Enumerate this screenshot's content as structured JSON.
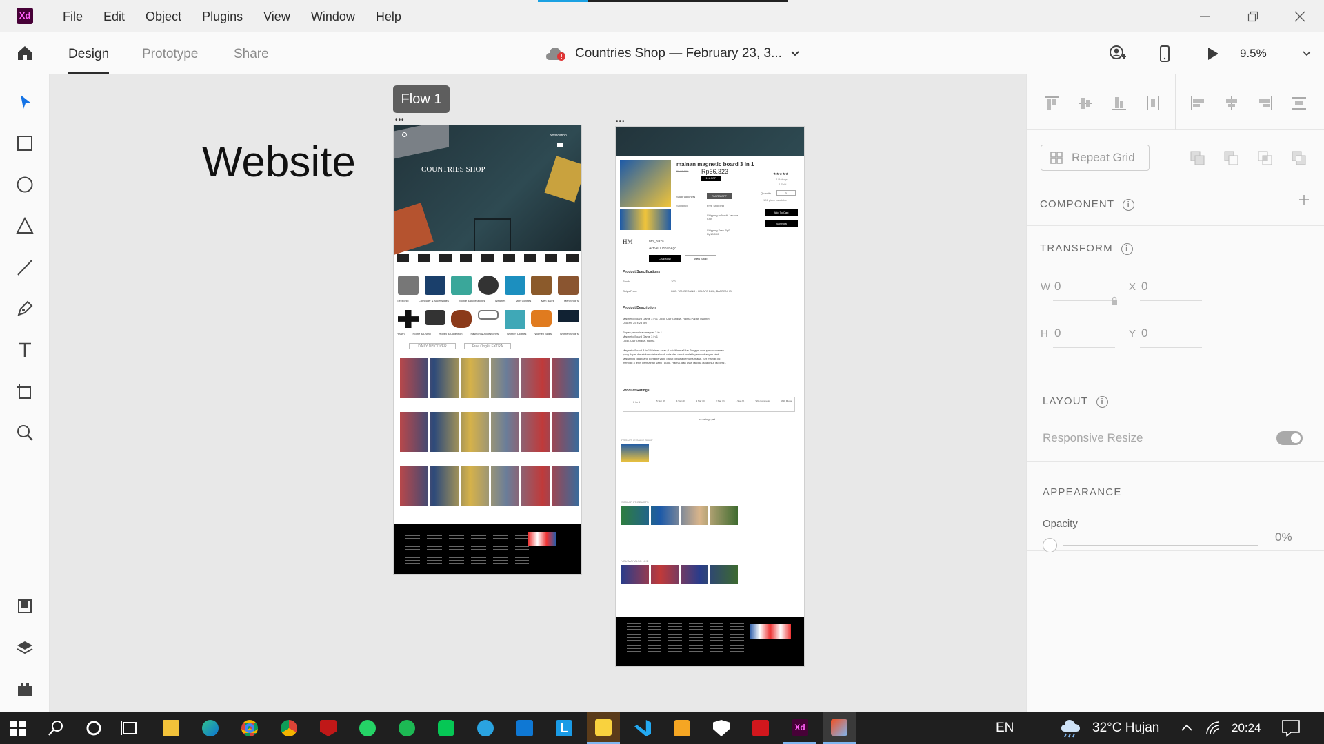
{
  "app": {
    "logo_text": "Xd",
    "accent": "#470137",
    "logo_color": "#ff61f6"
  },
  "menu": [
    "File",
    "Edit",
    "Object",
    "Plugins",
    "View",
    "Window",
    "Help"
  ],
  "window_controls": {
    "minimize": "minimize-icon",
    "restore": "restore-icon",
    "close": "close-icon"
  },
  "toolbar": {
    "tabs": [
      {
        "label": "Design",
        "active": true
      },
      {
        "label": "Prototype",
        "active": false
      },
      {
        "label": "Share",
        "active": false
      }
    ],
    "doc_title": "Countries Shop — February 23, 3...",
    "zoom": "9.5%",
    "icons": [
      "home-icon",
      "cloud-alert-icon",
      "user-invite-icon",
      "mobile-preview-icon",
      "play-icon",
      "chevron-down-icon"
    ]
  },
  "tools": [
    "select-icon",
    "rectangle-icon",
    "ellipse-icon",
    "triangle-icon",
    "line-icon",
    "pen-icon",
    "text-icon",
    "artboard-icon",
    "zoom-icon",
    "assets-icon",
    "layers-icon",
    "plugins-icon"
  ],
  "canvas": {
    "website_label": "Website",
    "flow_label": "Flow 1"
  },
  "artboard_home": {
    "brand": "COUNTRIES SHOP",
    "notification": "Notification",
    "categories_row1": [
      "Electronic",
      "Computer & Accessories",
      "Mobile & Accessories",
      "Watches",
      "Men Clothes",
      "Men Bag's",
      "Men Shoe's"
    ],
    "categories_row2": [
      "Health",
      "Home & Living",
      "Hobby & Collection",
      "Fashion & Accessories",
      "Women Clothes",
      "Women Bag's",
      "Women Shoe's"
    ],
    "tabs": [
      "DAILY DISCOVER",
      "Free Ongkir EXTRA"
    ]
  },
  "artboard_product": {
    "product_name": "mainan magnetic board 3 in 1",
    "old_price": "Rp67.000",
    "price": "Rp66.323",
    "discount": "1% OFF",
    "voucher_label": "Shop Vouchers",
    "voucher": "Rp5RB OFF",
    "shipping_label": "Shipping",
    "free_shipping": "Free Shipping",
    "shipping_to": "Shipping to North Jakarta City",
    "shipping_fee": "Shipping Free Rp0 - Rp18.000",
    "ratings": "4 Ratings",
    "sold": "2 Sold",
    "quantity_label": "Quantity",
    "quantity": "1",
    "available": "102 piece available",
    "add_to_cart": "Add To Cart",
    "buy_now": "Buy Now",
    "shop_name": "hm_plaza",
    "shop_active": "Active 1 Hour Ago",
    "chat_now": "Chat Now",
    "view_shop": "View Shop",
    "spec_title": "Product Specifications",
    "stock_label": "Stock",
    "stock": "102",
    "ships_from_label": "Ships From",
    "ships_from": "KAB. TANGERANG - KELAPA DUA, BANTEN, ID",
    "desc_title": "Product Description",
    "desc_lines": [
      "Magnetic Board Game 3 in 1 Ludo, Ular Tangga, Halma Papan Magnet",
      "Ukuran: 25 x 25 cm",
      "Papan permainan magnet 3 in 1",
      "Magnetic Board Game 3 in 1",
      "Ludo, Ular Tangga, Halma",
      "Magnetic Board 3 In 1 Mainan Anak (Ludo/Halma/Ular Tangga) merupakan mainan",
      "yang dapat dimainkan oleh seluruh usia dan dapat melatih perkembangan otak.",
      "Mainan ini dirancang portable yang dapat dibawa kemana-mana. Set mainan ini",
      "memiliki 3 jenis permainan yaitu : Ludo, Halma, dan Ular Tangga (snakes & ladders)."
    ],
    "ratings_title": "Product Ratings",
    "rating_score": "0 to 5",
    "rating_filters": [
      "5 Star (0)",
      "4 Star (0)",
      "3 Star (0)",
      "2 Star (0)",
      "1 Star (0)",
      "With Comments",
      "With Media"
    ],
    "no_ratings": "no ratings yet",
    "same_shop": "FROM THE SAME SHOP",
    "similar": "SIMILAR PRODUCTS",
    "may_like": "YOU MAY ALSO LIKE"
  },
  "panel": {
    "repeat_grid": "Repeat Grid",
    "component": "COMPONENT",
    "transform": "TRANSFORM",
    "w_label": "W",
    "w": "0",
    "x_label": "X",
    "x": "0",
    "h_label": "H",
    "h": "0",
    "y_label": "Y",
    "y": "0",
    "layout": "LAYOUT",
    "responsive_resize": "Responsive Resize",
    "appearance": "APPEARANCE",
    "opacity_label": "Opacity",
    "opacity": "0%"
  },
  "taskbar": {
    "apps": [
      "windows-start-icon",
      "search-icon",
      "cortana-icon",
      "task-view-icon",
      "file-explorer-icon",
      "edge-icon",
      "chrome-icon",
      "chrome-profile-icon",
      "mcafee-icon",
      "whatsapp-icon",
      "spotify-icon",
      "line-icon",
      "telegram-icon",
      "mail-icon",
      "lingo-icon",
      "sticky-notes-icon",
      "vscode-icon",
      "media-player-icon",
      "security-icon",
      "acrobat-icon",
      "xd-icon",
      "paint-icon"
    ],
    "language": "EN",
    "weather": "32°C Hujan",
    "time": "20:24"
  }
}
